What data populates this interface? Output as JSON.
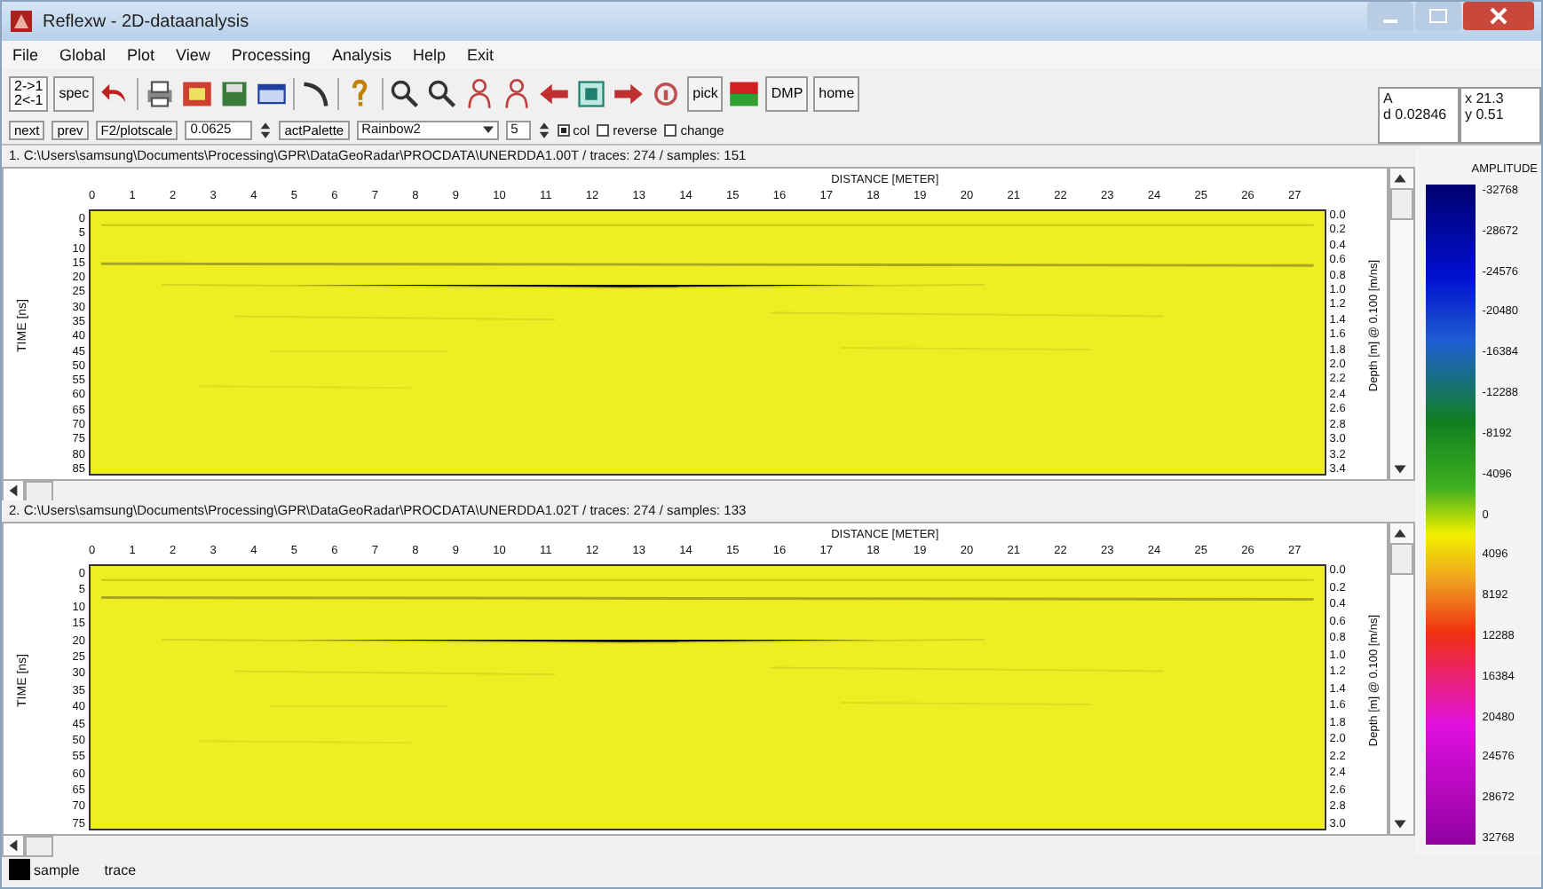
{
  "window": {
    "title": "Reflexw - 2D-dataanalysis"
  },
  "menu": [
    "File",
    "Global",
    "Plot",
    "View",
    "Processing",
    "Analysis",
    "Help",
    "Exit"
  ],
  "toolbar": {
    "swap_labels": [
      "2->1",
      "2<-1"
    ],
    "spec": "spec",
    "pick": "pick",
    "dmp": "DMP",
    "home": "home"
  },
  "options": {
    "next": "next",
    "prev": "prev",
    "plotscale": "F2/plotscale",
    "scale_value": "0.0625",
    "palette_button": "actPalette",
    "palette": "Rainbow2",
    "palette_index": "5",
    "checks": [
      {
        "label": "col",
        "checked": true
      },
      {
        "label": "reverse",
        "checked": false
      },
      {
        "label": "change",
        "checked": false
      }
    ]
  },
  "readouts": [
    {
      "lines": [
        "A",
        "d 0.02846"
      ]
    },
    {
      "lines": [
        "x 21.3",
        "y 0.51"
      ]
    }
  ],
  "panels": [
    {
      "path": "1. C:\\Users\\samsung\\Documents\\Processing\\GPR\\DataGeoRadar\\PROCDATA\\UNERDDA1.00T / traces: 274 / samples: 151",
      "distance_label": "DISTANCE [METER]",
      "distance_ticks": [
        "0",
        "1",
        "2",
        "3",
        "4",
        "5",
        "6",
        "7",
        "8",
        "9",
        "10",
        "11",
        "12",
        "13",
        "14",
        "15",
        "16",
        "17",
        "18",
        "19",
        "20",
        "21",
        "22",
        "23",
        "24",
        "25",
        "26",
        "27"
      ],
      "time_label": "TIME [ns]",
      "time_ticks": [
        "0",
        "5",
        "10",
        "15",
        "20",
        "25",
        "30",
        "35",
        "40",
        "45",
        "50",
        "55",
        "60",
        "65",
        "70",
        "75",
        "80",
        "85"
      ],
      "depth_label": "Depth [m] @ 0.100 [m/ns]",
      "depth_ticks": [
        "0.0",
        "0.2",
        "0.4",
        "0.6",
        "0.8",
        "1.0",
        "1.2",
        "1.4",
        "1.6",
        "1.8",
        "2.0",
        "2.2",
        "2.4",
        "2.6",
        "2.8",
        "3.0",
        "3.2",
        "3.4"
      ]
    },
    {
      "path": "2. C:\\Users\\samsung\\Documents\\Processing\\GPR\\DataGeoRadar\\PROCDATA\\UNERDDA1.02T / traces: 274 / samples: 133",
      "distance_label": "DISTANCE [METER]",
      "distance_ticks": [
        "0",
        "1",
        "2",
        "3",
        "4",
        "5",
        "6",
        "7",
        "8",
        "9",
        "10",
        "11",
        "12",
        "13",
        "14",
        "15",
        "16",
        "17",
        "18",
        "19",
        "20",
        "21",
        "22",
        "23",
        "24",
        "25",
        "26",
        "27"
      ],
      "time_label": "TIME [ns]",
      "time_ticks": [
        "0",
        "5",
        "10",
        "15",
        "20",
        "25",
        "30",
        "35",
        "40",
        "45",
        "50",
        "55",
        "60",
        "65",
        "70",
        "75"
      ],
      "depth_label": "Depth [m] @ 0.100 [m/ns]",
      "depth_ticks": [
        "0.0",
        "0.2",
        "0.4",
        "0.6",
        "0.8",
        "1.0",
        "1.2",
        "1.4",
        "1.6",
        "1.8",
        "2.0",
        "2.2",
        "2.4",
        "2.6",
        "2.8",
        "3.0"
      ]
    }
  ],
  "legend": {
    "title": "AMPLITUDE",
    "labels": [
      "-32768",
      "-28672",
      "-24576",
      "-20480",
      "-16384",
      "-12288",
      "-8192",
      "-4096",
      "0",
      "4096",
      "8192",
      "12288",
      "16384",
      "20480",
      "24576",
      "28672",
      "32768"
    ]
  },
  "status": [
    "sample",
    "trace"
  ]
}
